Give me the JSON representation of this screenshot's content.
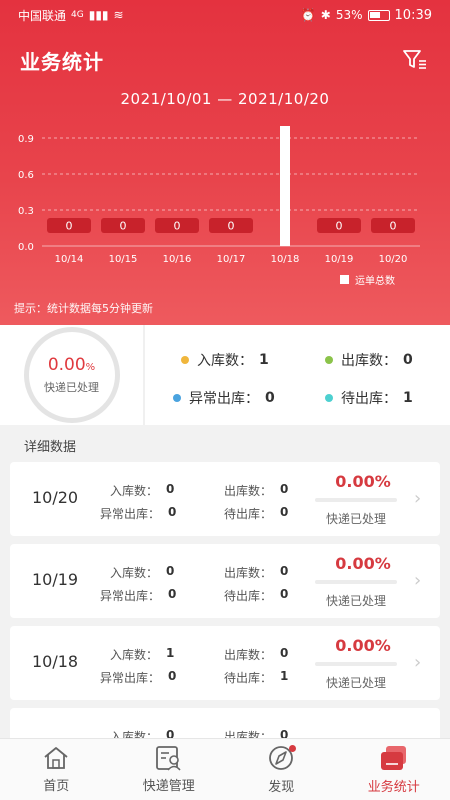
{
  "status_bar": {
    "carrier": "中国联通",
    "network": "4G",
    "battery": "53%",
    "time": "10:39"
  },
  "header": {
    "title": "业务统计",
    "filter_icon": "filter-icon"
  },
  "date_range": "2021/10/01 — 2021/10/20",
  "chart_data": {
    "type": "bar",
    "categories": [
      "10/14",
      "10/15",
      "10/16",
      "10/17",
      "10/18",
      "10/19",
      "10/20"
    ],
    "series": [
      {
        "name": "运单总数",
        "values": [
          0,
          0,
          0,
          0,
          1,
          0,
          0
        ]
      }
    ],
    "y_ticks": [
      "0.0",
      "0.3",
      "0.6",
      "0.9"
    ],
    "ylim": [
      0,
      1
    ],
    "grid": true,
    "legend": "bottom-right",
    "bar_color": "#ffffff",
    "zero_label_color": "#c8222b"
  },
  "legend_label": "运单总数",
  "hint": "提示：统计数据每5分钟更新",
  "summary": {
    "processed_value": "0.00",
    "processed_unit": "%",
    "processed_label": "快递已处理",
    "stats": [
      {
        "label": "入库数：",
        "value": "1",
        "color": "#f0b63c"
      },
      {
        "label": "出库数：",
        "value": "0",
        "color": "#8bc34a"
      },
      {
        "label": "异常出库：",
        "value": "0",
        "color": "#4aa3df"
      },
      {
        "label": "待出库：",
        "value": "1",
        "color": "#4dd0d0"
      }
    ]
  },
  "section_label": "详细数据",
  "rows": [
    {
      "date": "10/20",
      "in": "0",
      "out": "0",
      "abnormal": "0",
      "pending": "0",
      "pct": "0.00%",
      "pct_value": 0.0
    },
    {
      "date": "10/19",
      "in": "0",
      "out": "0",
      "abnormal": "0",
      "pending": "0",
      "pct": "0.00%",
      "pct_value": 0.0
    },
    {
      "date": "10/18",
      "in": "1",
      "out": "0",
      "abnormal": "0",
      "pending": "1",
      "pct": "0.00%",
      "pct_value": 0.0
    },
    {
      "date": "",
      "in": "0",
      "out": "0",
      "abnormal": "",
      "pending": "",
      "pct": "",
      "pct_value": 0.0
    }
  ],
  "row_labels": {
    "in": "入库数：",
    "out": "出库数：",
    "abnormal": "异常出库：",
    "pending": "待出库：",
    "sub": "快递已处理"
  },
  "tabs": [
    {
      "label": "首页",
      "icon": "home-icon",
      "active": false
    },
    {
      "label": "快递管理",
      "icon": "package-manage-icon",
      "active": false
    },
    {
      "label": "发现",
      "icon": "compass-icon",
      "active": false,
      "badge": true
    },
    {
      "label": "业务统计",
      "icon": "stats-icon",
      "active": true
    }
  ]
}
